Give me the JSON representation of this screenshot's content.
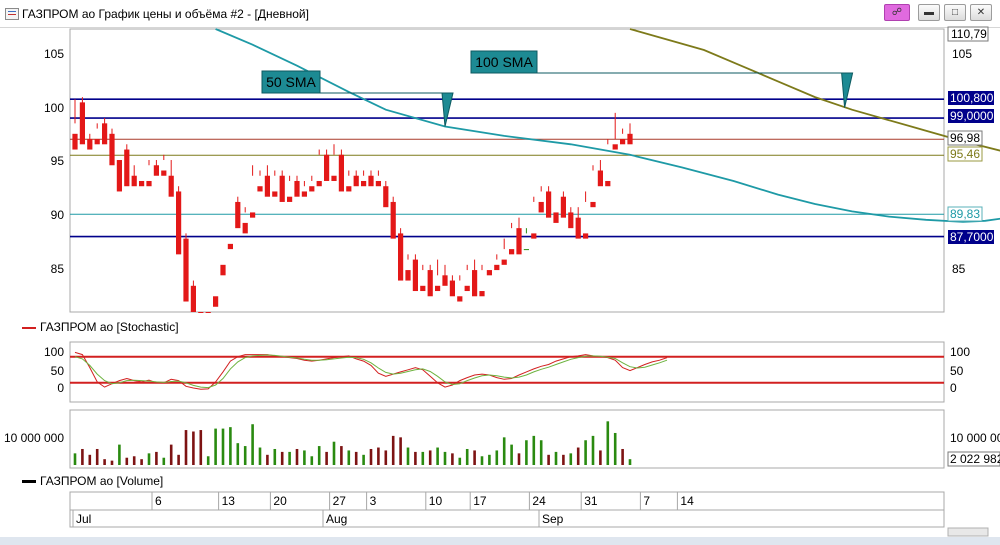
{
  "window": {
    "title": "ГАЗПРОМ ао График цены и объёма #2 - [Дневной]",
    "buttons": {
      "pin": "pin",
      "minimize": "minimize",
      "maximize": "maximize",
      "close": "close"
    }
  },
  "colors": {
    "up": "#2a8a10",
    "down": "#e31818",
    "volume_up": "#2a8a10",
    "volume_down": "#7d1313",
    "sma50": "#1e9aa6",
    "sma100": "#7d7a1a",
    "level_blue": "#00008b",
    "level_red": "#a93a2a",
    "stoch_k": "#d22020",
    "stoch_d": "#6db33f",
    "callout_fill": "#1d8a93",
    "arrow": "#b07a55"
  },
  "price_panel": {
    "left_ticks": [
      "105",
      "100",
      "95",
      "90",
      "85"
    ],
    "right_ticks": [
      "105",
      "85"
    ],
    "callouts": [
      {
        "text": "50 SMA"
      },
      {
        "text": "100 SMA"
      }
    ],
    "right_labels": [
      {
        "text": "110,79",
        "style": "plain"
      },
      {
        "text": "100,800",
        "style": "blue"
      },
      {
        "text": "99,0000",
        "style": "blue"
      },
      {
        "text": "96,98",
        "style": "plain"
      },
      {
        "text": "95,46",
        "style": "olive"
      },
      {
        "text": "89,83",
        "style": "teal"
      },
      {
        "text": "87,7000",
        "style": "blue"
      }
    ]
  },
  "stochastic_panel": {
    "label": "ГАЗПРОМ ао [Stochastic]",
    "left_ticks": [
      "100",
      "50",
      "0"
    ],
    "right_ticks": [
      "100",
      "50",
      "0"
    ]
  },
  "volume_panel": {
    "left_tick": "10 000 000",
    "right_tick": "10 000 000",
    "last_value": "2 022 982",
    "label": "ГАЗПРОМ ао [Volume]"
  },
  "date_axis": {
    "days": [
      "6",
      "13",
      "20",
      "27",
      "3",
      "10",
      "17",
      "24",
      "31",
      "7",
      "14"
    ],
    "months": [
      "Jul",
      "Aug",
      "Sep"
    ]
  },
  "chart_data": [
    {
      "type": "candlestick",
      "name": "ГАЗПРОМ ао",
      "ylim": [
        80.5,
        107.5
      ],
      "candles": [
        [
          97.5,
          100.8,
          98.5,
          96.0
        ],
        [
          100.5,
          101.0,
          97.0,
          96.5
        ],
        [
          97.0,
          97.5,
          96.8,
          96.0
        ],
        [
          97.0,
          98.5,
          98.0,
          96.5
        ],
        [
          98.5,
          99.0,
          97.5,
          96.5
        ],
        [
          97.5,
          98.0,
          95.0,
          94.5
        ],
        [
          95.0,
          96.0,
          96.0,
          92.0
        ],
        [
          96.0,
          96.5,
          93.5,
          92.5
        ],
        [
          93.5,
          94.5,
          93.0,
          92.5
        ],
        [
          93.0,
          93.5,
          93.5,
          92.5
        ],
        [
          93.0,
          95.0,
          94.5,
          92.5
        ],
        [
          94.5,
          95.0,
          94.0,
          93.5
        ],
        [
          94.0,
          95.5,
          95.0,
          93.5
        ],
        [
          93.5,
          95.0,
          92.0,
          91.5
        ],
        [
          92.0,
          92.5,
          87.5,
          86.0
        ],
        [
          87.5,
          88.0,
          83.0,
          81.5
        ],
        [
          83.0,
          83.5,
          79.0,
          78.0
        ],
        [
          79.0,
          80.0,
          77.5,
          76.5
        ],
        [
          77.0,
          78.0,
          79.0,
          76.5
        ],
        [
          82.0,
          85.0,
          85.0,
          81.0
        ],
        [
          85.0,
          87.0,
          87.0,
          84.0
        ],
        [
          87.0,
          91.0,
          91.0,
          86.5
        ],
        [
          91.0,
          91.5,
          89.0,
          88.5
        ],
        [
          89.0,
          90.5,
          90.0,
          88.0
        ],
        [
          90.0,
          94.5,
          93.5,
          89.5
        ],
        [
          92.5,
          94.0,
          93.5,
          92.0
        ],
        [
          93.5,
          94.5,
          92.0,
          91.5
        ],
        [
          92.0,
          94.0,
          93.5,
          91.5
        ],
        [
          93.5,
          94.0,
          91.5,
          91.0
        ],
        [
          91.5,
          93.5,
          93.0,
          91.0
        ],
        [
          93.0,
          93.5,
          92.0,
          91.5
        ],
        [
          92.0,
          93.0,
          92.5,
          91.5
        ],
        [
          92.5,
          93.5,
          93.0,
          92.0
        ],
        [
          93.0,
          96.0,
          95.5,
          92.5
        ],
        [
          95.5,
          96.0,
          93.5,
          93.0
        ],
        [
          93.5,
          96.5,
          95.5,
          93.0
        ],
        [
          95.5,
          96.0,
          92.5,
          92.0
        ],
        [
          92.5,
          94.0,
          93.5,
          92.0
        ],
        [
          93.5,
          94.0,
          93.0,
          92.5
        ],
        [
          93.0,
          94.0,
          93.5,
          92.5
        ],
        [
          93.5,
          94.0,
          93.0,
          92.5
        ],
        [
          93.0,
          94.0,
          93.5,
          92.5
        ],
        [
          92.5,
          93.0,
          91.0,
          90.5
        ],
        [
          91.0,
          91.5,
          88.0,
          87.5
        ],
        [
          88.0,
          88.5,
          84.0,
          83.5
        ],
        [
          84.5,
          86.0,
          85.5,
          83.5
        ],
        [
          85.5,
          86.0,
          83.0,
          82.5
        ],
        [
          83.0,
          85.0,
          84.5,
          82.5
        ],
        [
          84.5,
          85.0,
          83.0,
          82.0
        ],
        [
          83.0,
          85.5,
          84.0,
          82.5
        ],
        [
          84.0,
          85.0,
          83.5,
          83.0
        ],
        [
          83.5,
          84.0,
          82.5,
          82.0
        ],
        [
          82.0,
          84.0,
          83.5,
          81.5
        ],
        [
          83.0,
          85.0,
          84.5,
          82.5
        ],
        [
          84.5,
          85.5,
          82.5,
          82.0
        ],
        [
          82.5,
          85.0,
          84.5,
          82.0
        ],
        [
          84.5,
          85.0,
          85.0,
          84.0
        ],
        [
          85.0,
          86.0,
          85.5,
          84.5
        ],
        [
          85.5,
          87.5,
          86.5,
          85.0
        ],
        [
          86.5,
          89.0,
          88.5,
          86.0
        ],
        [
          88.5,
          89.5,
          86.5,
          86.0
        ],
        [
          86.5,
          88.5,
          88.0,
          86.5
        ],
        [
          88.0,
          91.5,
          91.0,
          87.5
        ],
        [
          91.0,
          92.5,
          92.0,
          90.0
        ],
        [
          92.0,
          92.5,
          90.0,
          89.5
        ],
        [
          90.0,
          91.5,
          91.5,
          89.0
        ],
        [
          91.5,
          92.0,
          90.0,
          89.5
        ],
        [
          90.0,
          90.5,
          89.5,
          88.5
        ],
        [
          89.5,
          90.5,
          88.0,
          87.5
        ],
        [
          88.0,
          92.0,
          91.0,
          87.5
        ],
        [
          91.0,
          94.5,
          94.0,
          90.5
        ],
        [
          94.0,
          95.0,
          93.0,
          92.5
        ],
        [
          93.0,
          97.0,
          96.5,
          92.5
        ],
        [
          96.5,
          99.5,
          97.0,
          96.0
        ],
        [
          97.0,
          98.0,
          97.5,
          96.5
        ],
        [
          97.5,
          98.5,
          96.98,
          96.5
        ]
      ],
      "sma50": [
        [
          19,
          107.5
        ],
        [
          24,
          106.0
        ],
        [
          30,
          104.0
        ],
        [
          37,
          101.5
        ],
        [
          42,
          99.8
        ],
        [
          50,
          98.2
        ],
        [
          58,
          97.3
        ],
        [
          67,
          96.5
        ],
        [
          75,
          95.5
        ],
        [
          82,
          94.3
        ],
        [
          89,
          93.0
        ],
        [
          95,
          91.7
        ],
        [
          100,
          90.8
        ],
        [
          105,
          90.1
        ],
        [
          110,
          89.6
        ],
        [
          115,
          89.3
        ],
        [
          120,
          89.1
        ],
        [
          123,
          89.2
        ],
        [
          126,
          89.5
        ],
        [
          129,
          89.83
        ]
      ],
      "sma100": [
        [
          75,
          107.5
        ],
        [
          80,
          106.5
        ],
        [
          85,
          105.5
        ],
        [
          90,
          104.0
        ],
        [
          95,
          102.5
        ],
        [
          100,
          101.0
        ],
        [
          105,
          99.8
        ],
        [
          110,
          98.8
        ],
        [
          115,
          97.8
        ],
        [
          120,
          96.8
        ],
        [
          125,
          95.9
        ],
        [
          129,
          95.46
        ]
      ],
      "levels": [
        {
          "value": 100.8,
          "color": "blue"
        },
        {
          "value": 99.0,
          "color": "blue"
        },
        {
          "value": 96.98,
          "color": "red"
        },
        {
          "value": 95.46,
          "color": "olive"
        },
        {
          "value": 89.83,
          "color": "teal"
        },
        {
          "value": 87.7,
          "color": "blue"
        }
      ],
      "annotations": [
        {
          "text": "50 SMA",
          "target": [
            50,
            98.2
          ]
        },
        {
          "text": "100 SMA",
          "target": [
            104,
            100.0
          ]
        }
      ],
      "projection": [
        [
          129,
          97.0
        ],
        [
          130,
          96.3
        ],
        [
          131,
          95.7
        ],
        [
          133,
          95.2
        ],
        [
          135,
          95.3
        ],
        [
          137,
          96.4
        ],
        [
          138,
          97.5
        ],
        [
          139,
          99.0
        ]
      ]
    },
    {
      "type": "line",
      "name": "ГАЗПРОМ ао [Stochastic]",
      "ylim": [
        -15,
        107
      ],
      "thresholds": [
        80,
        20
      ],
      "series": [
        {
          "name": "%K",
          "values": [
            90,
            85,
            55,
            22,
            10,
            18,
            25,
            30,
            25,
            22,
            26,
            20,
            20,
            28,
            25,
            12,
            8,
            5,
            6,
            22,
            45,
            70,
            80,
            85,
            85,
            85,
            85,
            82,
            80,
            78,
            76,
            72,
            70,
            72,
            75,
            78,
            80,
            82,
            75,
            70,
            60,
            42,
            35,
            40,
            45,
            50,
            55,
            50,
            35,
            20,
            10,
            15,
            25,
            32,
            38,
            40,
            38,
            32,
            28,
            30,
            38,
            45,
            52,
            58,
            62,
            70,
            75,
            80,
            82,
            85,
            82,
            80,
            78,
            72,
            55,
            48,
            55,
            62,
            68,
            72,
            78
          ]
        },
        {
          "name": "%D",
          "values": [
            80,
            75,
            60,
            40,
            25,
            18,
            20,
            25,
            26,
            25,
            24,
            22,
            21,
            23,
            24,
            20,
            14,
            10,
            9,
            15,
            30,
            52,
            68,
            78,
            82,
            83,
            84,
            83,
            81,
            79,
            77,
            74,
            72,
            72,
            73,
            75,
            77,
            79,
            78,
            74,
            66,
            54,
            44,
            40,
            42,
            46,
            50,
            52,
            46,
            35,
            22,
            16,
            18,
            25,
            31,
            36,
            38,
            36,
            33,
            31,
            33,
            38,
            45,
            51,
            56,
            62,
            68,
            74,
            78,
            81,
            82,
            81,
            79,
            76,
            66,
            57,
            54,
            56,
            61,
            66,
            72
          ]
        }
      ]
    },
    {
      "type": "bar",
      "name": "ГАЗПРОМ ао [Volume]",
      "ylim": [
        0,
        18200000
      ],
      "values": [
        [
          4000000,
          0
        ],
        [
          5500000,
          1
        ],
        [
          3500000,
          1
        ],
        [
          5500000,
          1
        ],
        [
          2000000,
          1
        ],
        [
          1500000,
          1
        ],
        [
          7000000,
          0
        ],
        [
          2500000,
          1
        ],
        [
          3000000,
          1
        ],
        [
          2000000,
          1
        ],
        [
          4000000,
          0
        ],
        [
          4500000,
          1
        ],
        [
          2500000,
          0
        ],
        [
          7000000,
          1
        ],
        [
          3500000,
          1
        ],
        [
          12000000,
          1
        ],
        [
          11500000,
          1
        ],
        [
          12000000,
          1
        ],
        [
          3000000,
          0
        ],
        [
          12500000,
          0
        ],
        [
          12500000,
          0
        ],
        [
          13000000,
          0
        ],
        [
          7500000,
          0
        ],
        [
          6500000,
          0
        ],
        [
          14000000,
          0
        ],
        [
          6000000,
          0
        ],
        [
          3500000,
          1
        ],
        [
          5500000,
          0
        ],
        [
          4500000,
          1
        ],
        [
          4500000,
          0
        ],
        [
          5500000,
          1
        ],
        [
          5000000,
          0
        ],
        [
          3000000,
          0
        ],
        [
          6500000,
          0
        ],
        [
          4500000,
          1
        ],
        [
          8000000,
          0
        ],
        [
          6500000,
          1
        ],
        [
          5000000,
          0
        ],
        [
          4500000,
          1
        ],
        [
          3500000,
          0
        ],
        [
          5500000,
          1
        ],
        [
          6000000,
          1
        ],
        [
          5000000,
          1
        ],
        [
          10000000,
          1
        ],
        [
          9500000,
          1
        ],
        [
          6000000,
          0
        ],
        [
          4500000,
          1
        ],
        [
          4500000,
          0
        ],
        [
          5000000,
          1
        ],
        [
          6000000,
          0
        ],
        [
          4500000,
          0
        ],
        [
          4000000,
          1
        ],
        [
          2500000,
          0
        ],
        [
          5500000,
          0
        ],
        [
          5000000,
          1
        ],
        [
          3000000,
          0
        ],
        [
          3500000,
          0
        ],
        [
          5000000,
          0
        ],
        [
          9500000,
          0
        ],
        [
          7000000,
          0
        ],
        [
          4000000,
          1
        ],
        [
          8500000,
          0
        ],
        [
          10000000,
          0
        ],
        [
          8500000,
          0
        ],
        [
          3500000,
          1
        ],
        [
          4500000,
          0
        ],
        [
          3500000,
          1
        ],
        [
          4000000,
          0
        ],
        [
          6000000,
          1
        ],
        [
          8500000,
          0
        ],
        [
          10000000,
          0
        ],
        [
          5000000,
          1
        ],
        [
          15000000,
          0
        ],
        [
          11000000,
          0
        ],
        [
          5500000,
          1
        ],
        [
          2000000,
          0
        ]
      ]
    }
  ]
}
